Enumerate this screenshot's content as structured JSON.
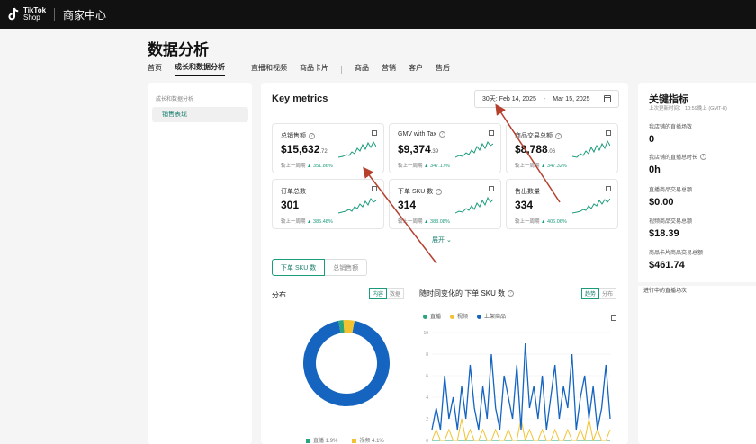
{
  "topbar": {
    "logo_line1": "TikTok",
    "logo_line2": "Shop",
    "title": "商家中心"
  },
  "page": {
    "title": "数据分析"
  },
  "nav": {
    "items": [
      {
        "label": "首页",
        "active": false
      },
      {
        "label": "成长和数据分析",
        "active": true
      },
      {
        "label": "直播和视频",
        "active": false
      },
      {
        "label": "商品卡片",
        "active": false
      },
      {
        "label": "商品",
        "active": false
      },
      {
        "label": "营销",
        "active": false
      },
      {
        "label": "客户",
        "active": false
      },
      {
        "label": "售后",
        "active": false
      }
    ]
  },
  "leftnav": {
    "group": "成长和数据分析",
    "item": "销售表现"
  },
  "main": {
    "title": "Key metrics",
    "date_prefix": "30天:",
    "date_start": "Feb 14, 2025",
    "date_end": "Mar 15, 2025",
    "expand_label": "展开",
    "cards": [
      {
        "label": "总销售额",
        "value_main": "$15,632",
        "value_dec": ".72",
        "cmp_label": "较上一周期",
        "cmp_value": "▲ 351.86%"
      },
      {
        "label": "GMV with Tax",
        "value_main": "$9,374",
        "value_dec": ".39",
        "cmp_label": "较上一周期",
        "cmp_value": "▲ 347.17%"
      },
      {
        "label": "商品交易总额",
        "value_main": "$8,788",
        "value_dec": ".06",
        "cmp_label": "较上一周期",
        "cmp_value": "▲ 347.32%"
      },
      {
        "label": "订单总数",
        "value_main": "301",
        "value_dec": "",
        "cmp_label": "较上一周期",
        "cmp_value": "▲ 385.48%"
      },
      {
        "label": "下单 SKU 数",
        "value_main": "314",
        "value_dec": "",
        "cmp_label": "较上一周期",
        "cmp_value": "▲ 383.08%"
      },
      {
        "label": "售出数量",
        "value_main": "334",
        "value_dec": "",
        "cmp_label": "较上一周期",
        "cmp_value": "▲ 406.06%"
      }
    ],
    "segment": {
      "on": "下单 SKU 数",
      "off": "总销售额"
    },
    "distribution": {
      "title": "分布",
      "toggle_on": "内容",
      "toggle_off": "数据"
    },
    "trend": {
      "title": "随时间变化的 下单 SKU 数",
      "toggle_on": "趋势",
      "toggle_off": "分布"
    },
    "legend": [
      "直播",
      "视频",
      "上架商品"
    ],
    "bottom_legend": [
      {
        "label": "直播",
        "value": "1.9%"
      },
      {
        "label": "视频",
        "value": "4.1%"
      }
    ]
  },
  "colors": {
    "teal": "#1a9b7c",
    "blue": "#1565c0",
    "yellow": "#f2c230",
    "green": "#2aa57d",
    "arrow": "#b5402e"
  },
  "right_panel": {
    "title": "关键指标",
    "updated": "上次更新时间： 10:59晚上 (GMT-8)",
    "items": [
      {
        "label": "我店铺的直播场数",
        "value": "0"
      },
      {
        "label": "我店铺的直播总时长",
        "value": "0h"
      },
      {
        "label": "直播商品交易总额",
        "value": "$0.00"
      },
      {
        "label": "视频商品交易总额",
        "value": "$18.39"
      },
      {
        "label": "商品卡片商品交易总额",
        "value": "$461.74"
      }
    ],
    "live_label": "进行中的直播场次"
  },
  "chart_data": [
    {
      "type": "pie",
      "title": "",
      "categories": [
        "上架商品",
        "直播",
        "视频"
      ],
      "values": [
        94.0,
        1.9,
        4.1
      ]
    },
    {
      "type": "line",
      "title": "随时间变化的 下单 SKU 数",
      "ylim": [
        0,
        10
      ],
      "y_ticks": [
        10,
        8,
        6,
        4,
        2,
        0
      ],
      "series": [
        {
          "name": "上架商品",
          "values": [
            1,
            3,
            1,
            6,
            2,
            4,
            1,
            5,
            2,
            7,
            3,
            1,
            5,
            2,
            8,
            3,
            1,
            6,
            4,
            2,
            7,
            1,
            9,
            3,
            5,
            2,
            6,
            1,
            4,
            7,
            2,
            5,
            3,
            8,
            1,
            4,
            6,
            2,
            5,
            1,
            3,
            7,
            2
          ]
        },
        {
          "name": "视频",
          "values": [
            0,
            1,
            0,
            0,
            1,
            0,
            0,
            2,
            0,
            1,
            0,
            0,
            1,
            0,
            0,
            1,
            0,
            0,
            1,
            0,
            0,
            2,
            0,
            1,
            0,
            0,
            1,
            0,
            0,
            1,
            0,
            0,
            1,
            0,
            0,
            1,
            0,
            2,
            0,
            1,
            0,
            0,
            1
          ]
        },
        {
          "name": "直播",
          "values": [
            0,
            0,
            0,
            0,
            0,
            0,
            0,
            0,
            0,
            0,
            0,
            0,
            0,
            0,
            0,
            0,
            0,
            0,
            0,
            0,
            0,
            0,
            0,
            0,
            0,
            0,
            0,
            0,
            0,
            0,
            0,
            0,
            0,
            0,
            0,
            0,
            0,
            0,
            0,
            0,
            0,
            0,
            0
          ]
        }
      ]
    }
  ]
}
